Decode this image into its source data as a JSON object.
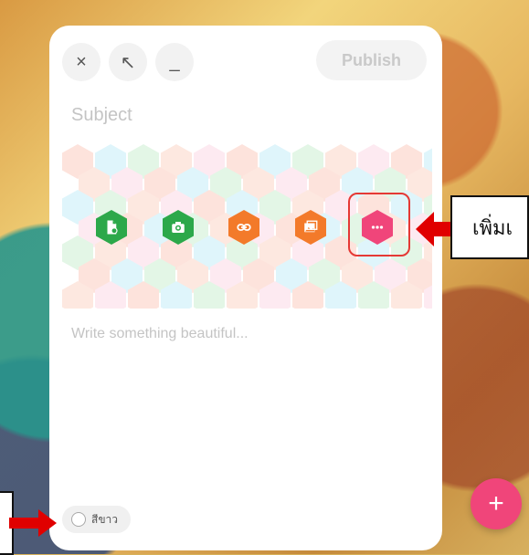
{
  "toolbar": {
    "close_icon": "×",
    "expand_icon": "↖",
    "minimize_icon": "_",
    "publish_label": "Publish"
  },
  "editor": {
    "subject_placeholder": "Subject",
    "body_placeholder": "Write something beautiful..."
  },
  "attach_tools": [
    {
      "name": "add-file",
      "icon": "file-icon",
      "color": "#2ca84a"
    },
    {
      "name": "add-photo",
      "icon": "camera-icon",
      "color": "#2ca84a"
    },
    {
      "name": "add-link",
      "icon": "link-icon",
      "color": "#f37a2a"
    },
    {
      "name": "add-image",
      "icon": "image-icon",
      "color": "#f37a2a"
    },
    {
      "name": "more",
      "icon": "more-icon",
      "color": "#f0457a"
    }
  ],
  "color_chip": {
    "label": "สีขาว"
  },
  "fab": {
    "label": "+"
  },
  "annotation": {
    "label": "เพิ่มเ"
  },
  "colors": {
    "panel": "#ffffff",
    "fab": "#f0457a",
    "highlight": "#e53935",
    "hex_palette": [
      "#fde3dc",
      "#dff5fb",
      "#e3f6e6",
      "#fde8e0",
      "#fdeaf1"
    ]
  }
}
